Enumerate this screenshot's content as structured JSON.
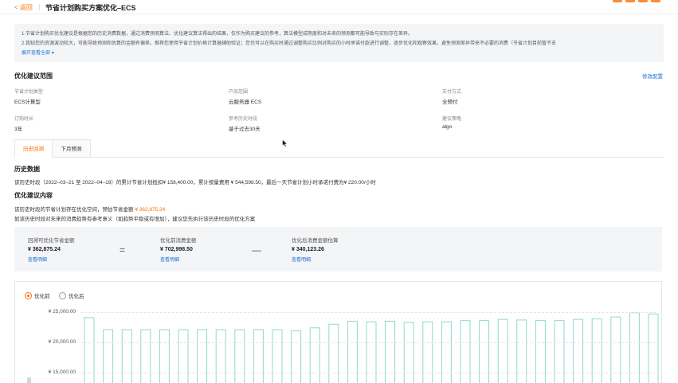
{
  "header": {
    "back_label": "< 返回",
    "title": "节省计划购买方案优化–ECS"
  },
  "notice": {
    "line1": "1.节省计划购买优化建议是根据您的历史消费数据，通过消费预测算法、优化建议算法得出的结果，仅作为购买建议的参考，算法模型成熟度和对未来的预测都可能导致与实际存在差异。",
    "line2": "2.我知您的资源波动较大，可能导致预测和估算的金额有偏差。推荐您使用节省计划价格计算器辅助验证；您也可以在购买时通过调整购买比例对购买的小时承诺付款进行调整，逐步优化和观察效果，避免预测差异带来不必要的消费（节省计划目前暂不支",
    "expand_label": "展开查看全部"
  },
  "scope": {
    "heading": "优化建议范围",
    "edit_label": "修改配置",
    "fields": [
      {
        "label": "节省计划类型",
        "value": "ECS计算型"
      },
      {
        "label": "产品范围",
        "value": "云服务器 ECS"
      },
      {
        "label": "支付方式",
        "value": "全预付"
      },
      {
        "label": "订购时长",
        "value": "3年"
      },
      {
        "label": "参考历史时段",
        "value": "基于过去30天"
      },
      {
        "label": "建议策略",
        "value": "algo"
      }
    ]
  },
  "tabs": [
    {
      "label": "历史回溯",
      "active": true
    },
    {
      "label": "下月预测",
      "active": false
    }
  ],
  "history": {
    "heading": "历史数据",
    "summary": "该历史时段（2022–03–21 至 2022–04–19）的累计节省计划抵扣¥ 158,400.00，累计按量费用 ¥ 544,598.50，最后一天节省计划小时承诺付费为¥ 220.00/小时"
  },
  "advice": {
    "heading": "优化建议内容",
    "line1_prefix": "该历史时段的节省计划存在优化空间，预估节省金额",
    "line1_amount": "¥ 362,875.24",
    "line2": "如该历史时段对未来的消费趋势有参考意义（如趋势平稳或有增加），建议您先执行该历史时段的优化方案"
  },
  "formula": {
    "saving_label": "回溯可优化节省金额",
    "saving_value": "¥ 362,875.24",
    "saving_link": "查看明细",
    "equals": "=",
    "before_label": "优化前消费金额",
    "before_value": "¥ 702,998.50",
    "before_link": "查看明细",
    "minus": "—",
    "after_label": "优化后消费金额估算",
    "after_value": "¥ 340,123.26",
    "after_link": "查看明细"
  },
  "chart_data": {
    "type": "bar",
    "radio_before": "优化前",
    "radio_after": "优化后",
    "selected": "优化前",
    "y_ticks": [
      "¥ 25,000.00",
      "¥ 20,000.00",
      "¥ 15,000.00"
    ],
    "ylim": [
      0,
      25000
    ],
    "values": [
      24100,
      22100,
      22100,
      22100,
      22100,
      22100,
      22100,
      22100,
      22100,
      22100,
      22100,
      21900,
      22400,
      23000,
      23500,
      23400,
      23500,
      23300,
      23400,
      23400,
      23600,
      23600,
      23800,
      23700,
      23600,
      23600,
      23800,
      23900,
      24200,
      24900,
      24700
    ],
    "bar_color": "#8fd9cc"
  }
}
